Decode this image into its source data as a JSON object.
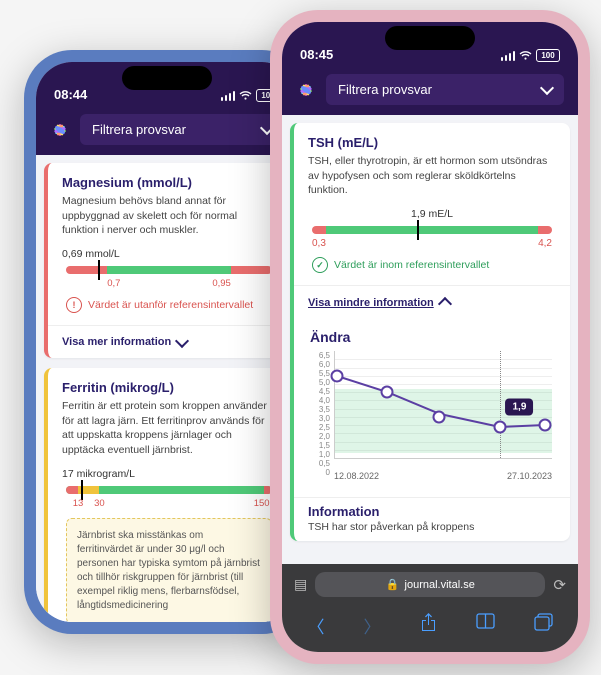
{
  "left": {
    "status_time": "08:44",
    "battery": "100",
    "filter_label": "Filtrera provsvar",
    "card1": {
      "title": "Magnesium (mmol/L)",
      "desc": "Magnesium behövs bland annat för uppbyggnad av skelett och för normal funktion i nerver och muskler.",
      "value": "0,69 mmol/L",
      "low": "0,7",
      "high": "0,95",
      "status": "Värdet är utanför referensintervallet",
      "expand": "Visa mer information"
    },
    "card2": {
      "title": "Ferritin (mikrog/L)",
      "desc": "Ferritin är ett protein som kroppen använder för att lagra järn. Ett ferritinprov används för att uppskatta kroppens järnlager och upptäcka eventuell järnbrist.",
      "value": "17 mikrogram/L",
      "lim_a": "13",
      "lim_b": "30",
      "lim_c": "150",
      "info": "Järnbrist ska misstänkas om ferritinvärdet är under 30 μg/l och personen har typiska symtom på järnbrist och tillhör riskgruppen för järnbrist (till exempel riklig mens, flerbarnsfödsel, långtidsmedicinering"
    }
  },
  "right": {
    "status_time": "08:45",
    "battery": "100",
    "filter_label": "Filtrera provsvar",
    "card": {
      "title": "TSH (mE/L)",
      "desc": "TSH, eller thyrotropin, är ett hormon som utsöndras av hypofysen och som reglerar sköldkörtelns funktion.",
      "value": "1,9 mE/L",
      "low": "0,3",
      "high": "4,2",
      "status": "Värdet är inom referensintervallet",
      "expand": "Visa mindre information"
    },
    "section_change": "Ändra",
    "tag_value": "1,9",
    "x1": "12.08.2022",
    "x2": "27.10.2023",
    "section_info_title": "Information",
    "section_info_body": "TSH har stor påverkan på kroppens",
    "url": "journal.vital.se"
  },
  "chart_data": {
    "type": "line",
    "title": "Ändra",
    "xlabel": "",
    "ylabel": "",
    "ylim": [
      0,
      6.5
    ],
    "y_ticks": [
      0,
      0.5,
      1.0,
      1.5,
      2.0,
      2.5,
      3.0,
      3.5,
      4.0,
      4.5,
      5.0,
      5.5,
      6.0,
      6.5
    ],
    "reference_range": [
      0.3,
      4.2
    ],
    "x": [
      "12.08.2022",
      "",
      "",
      "",
      "27.10.2023"
    ],
    "values": [
      5.0,
      4.0,
      2.5,
      1.9,
      2.0
    ],
    "highlight_index": 3,
    "highlight_value": 1.9
  }
}
